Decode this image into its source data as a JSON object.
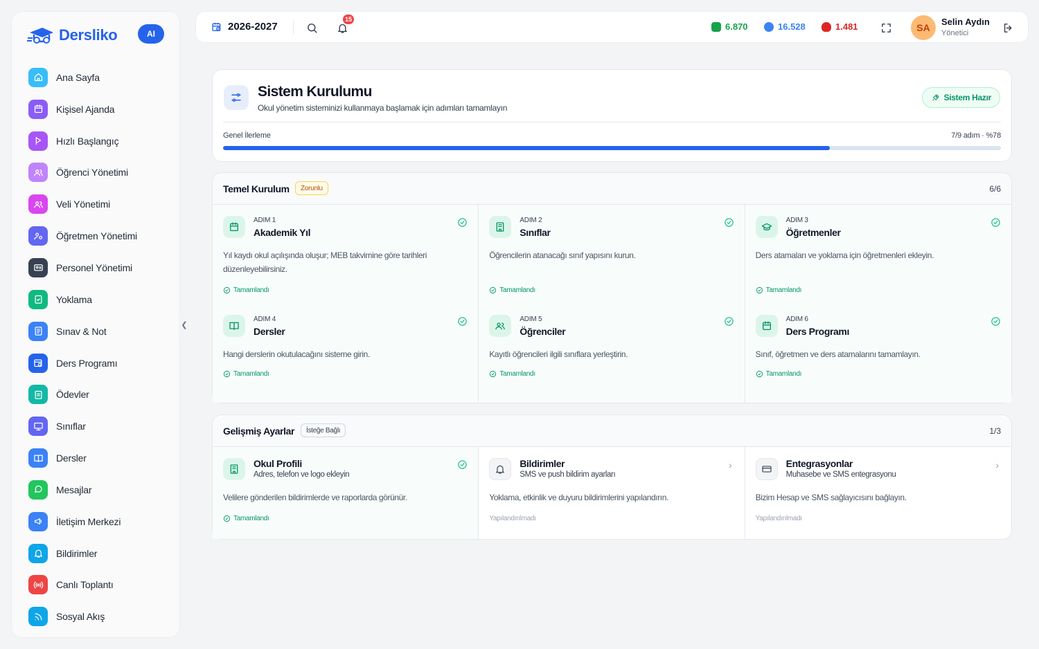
{
  "app": {
    "name": "Dersliko",
    "ai_badge": "AI"
  },
  "sidebar": {
    "items": [
      {
        "label": "Ana Sayfa",
        "icon": "home-icon",
        "color": "#38bdf8"
      },
      {
        "label": "Kişisel Ajanda",
        "icon": "calendar-icon",
        "color": "#8b5cf6"
      },
      {
        "label": "Hızlı Başlangıç",
        "icon": "flag-icon",
        "color": "#a855f7"
      },
      {
        "label": "Öğrenci Yönetimi",
        "icon": "users-icon",
        "color": "#c084fc"
      },
      {
        "label": "Veli Yönetimi",
        "icon": "users-icon",
        "color": "#d946ef"
      },
      {
        "label": "Öğretmen Yönetimi",
        "icon": "user-group-icon",
        "color": "#6366f1"
      },
      {
        "label": "Personel Yönetimi",
        "icon": "id-card-icon",
        "color": "#374151"
      },
      {
        "label": "Yoklama",
        "icon": "clipboard-check-icon",
        "color": "#10b981"
      },
      {
        "label": "Sınav & Not",
        "icon": "document-icon",
        "color": "#3b82f6"
      },
      {
        "label": "Ders Programı",
        "icon": "calendar-clock-icon",
        "color": "#2563eb"
      },
      {
        "label": "Ödevler",
        "icon": "clipboard-icon",
        "color": "#14b8a6"
      },
      {
        "label": "Sınıflar",
        "icon": "presentation-icon",
        "color": "#6366f1"
      },
      {
        "label": "Dersler",
        "icon": "book-icon",
        "color": "#3b82f6"
      },
      {
        "label": "Mesajlar",
        "icon": "chat-icon",
        "color": "#22c55e"
      },
      {
        "label": "İletişim Merkezi",
        "icon": "megaphone-icon",
        "color": "#3b82f6"
      },
      {
        "label": "Bildirimler",
        "icon": "bell-icon",
        "color": "#0ea5e9"
      },
      {
        "label": "Canlı Toplantı",
        "icon": "broadcast-icon",
        "color": "#ef4444"
      },
      {
        "label": "Sosyal Akış",
        "icon": "rss-icon",
        "color": "#0ea5e9"
      }
    ]
  },
  "topbar": {
    "year": "2026-2027",
    "notif_count": "15",
    "stats": [
      {
        "value": "6.870",
        "color": "#16a34a"
      },
      {
        "value": "16.528",
        "color": "#2563eb"
      },
      {
        "value": "1.481",
        "color": "#dc2626"
      }
    ],
    "user": {
      "initials": "SA",
      "name": "Selin Aydın",
      "role": "Yönetici"
    }
  },
  "setup": {
    "title": "Sistem Kurulumu",
    "subtitle": "Okul yönetim sisteminizi kullanmaya başlamak için adımları tamamlayın",
    "ready_label": "Sistem Hazır",
    "progress_label": "Genel İlerleme",
    "progress_text": "7/9 adım · %78",
    "progress_percent": 78
  },
  "basic": {
    "title": "Temel Kurulum",
    "tag": "Zorunlu",
    "count": "6/6",
    "steps": [
      {
        "num": "ADIM 1",
        "title": "Akademik Yıl",
        "desc": "Yıl kaydı okul açılışında oluşur; MEB takvimine göre tarihleri düzenleyebilirsiniz.",
        "status": "Tamamlandı"
      },
      {
        "num": "ADIM 2",
        "title": "Sınıflar",
        "desc": "Öğrencilerin atanacağı sınıf yapısını kurun.",
        "status": "Tamamlandı"
      },
      {
        "num": "ADIM 3",
        "title": "Öğretmenler",
        "desc": "Ders atamaları ve yoklama için öğretmenleri ekleyin.",
        "status": "Tamamlandı"
      },
      {
        "num": "ADIM 4",
        "title": "Dersler",
        "desc": "Hangi derslerin okutulacağını sisteme girin.",
        "status": "Tamamlandı"
      },
      {
        "num": "ADIM 5",
        "title": "Öğrenciler",
        "desc": "Kayıtlı öğrencileri ilgili sınıflara yerleştirin.",
        "status": "Tamamlandı"
      },
      {
        "num": "ADIM 6",
        "title": "Ders Programı",
        "desc": "Sınıf, öğretmen ve ders atamalarını tamamlayın.",
        "status": "Tamamlandı"
      }
    ]
  },
  "advanced": {
    "title": "Gelişmiş Ayarlar",
    "tag": "İsteğe Bağlı",
    "count": "1/3",
    "steps": [
      {
        "title": "Okul Profili",
        "sub": "Adres, telefon ve logo ekleyin",
        "desc": "Velilere gönderilen bildirimlerde ve raporlarda görünür.",
        "status": "Tamamlandı"
      },
      {
        "title": "Bildirimler",
        "sub": "SMS ve push bildirim ayarları",
        "desc": "Yoklama, etkinlik ve duyuru bildirimlerini yapılandırın.",
        "status": "Yapılandırılmadı"
      },
      {
        "title": "Entegrasyonlar",
        "sub": "Muhasebe ve SMS entegrasyonu",
        "desc": "Bizim Hesap ve SMS sağlayıcısını bağlayın.",
        "status": "Yapılandırılmadı"
      }
    ]
  }
}
